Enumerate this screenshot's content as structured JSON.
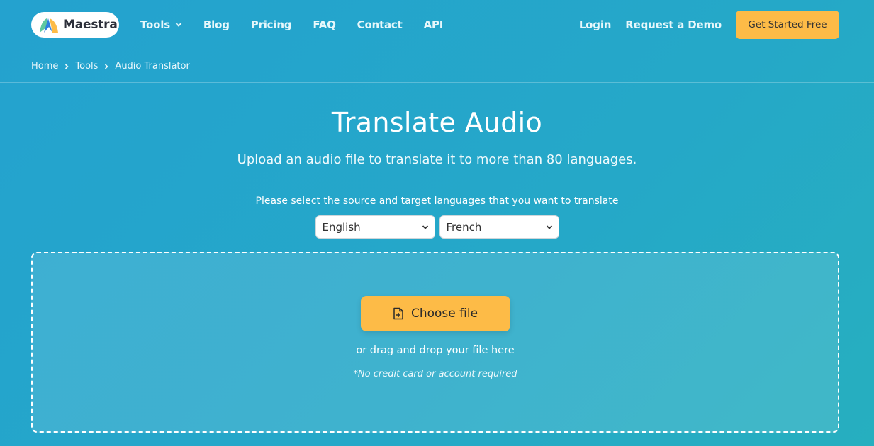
{
  "header": {
    "logo_text": "Maestra",
    "nav": [
      {
        "label": "Tools",
        "has_dropdown": true
      },
      {
        "label": "Blog"
      },
      {
        "label": "Pricing"
      },
      {
        "label": "FAQ"
      },
      {
        "label": "Contact"
      },
      {
        "label": "API"
      }
    ],
    "login": "Login",
    "request_demo": "Request a Demo",
    "cta": "Get Started Free"
  },
  "breadcrumb": [
    "Home",
    "Tools",
    "Audio Translator"
  ],
  "main": {
    "title": "Translate Audio",
    "subtitle": "Upload an audio file to translate it to more than 80 languages.",
    "select_label": "Please select the source and target languages that you want to translate",
    "source_language": "English",
    "target_language": "French",
    "choose_file": "Choose file",
    "drag_text": "or drag and drop your file here",
    "note": "*No credit card or account required"
  },
  "colors": {
    "accent": "#fdbb47",
    "background": "#24a5cc"
  }
}
